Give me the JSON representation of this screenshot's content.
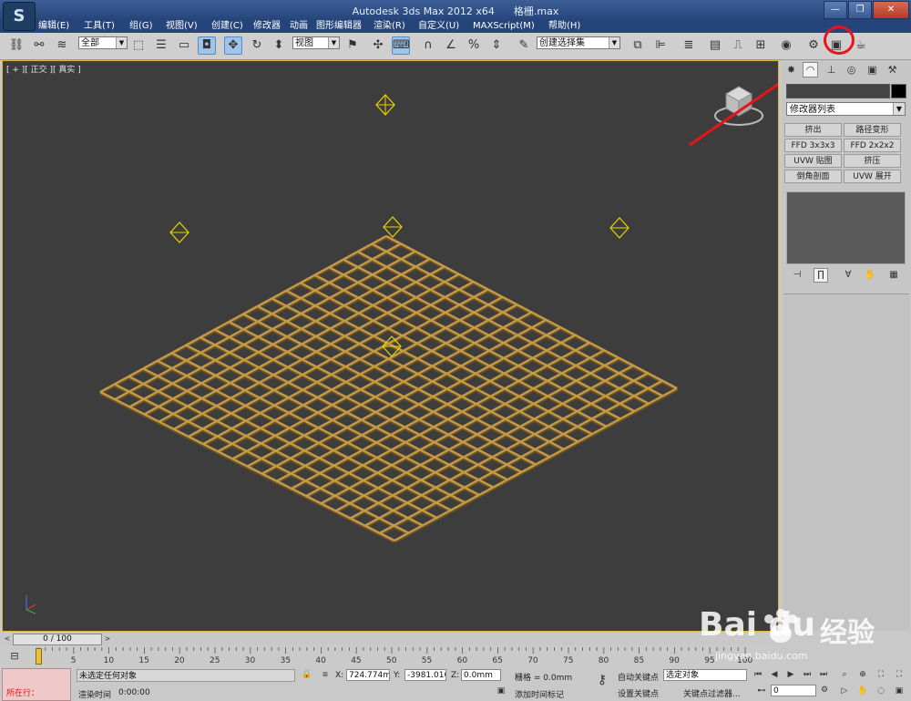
{
  "title": {
    "app": "Autodesk 3ds Max  2012 x64",
    "file": "格栅.max",
    "app_icon_letter": "S"
  },
  "window_buttons": {
    "minimize": "—",
    "restore": "❐",
    "close": "✕"
  },
  "menu": [
    "编辑(E)",
    "工具(T)",
    "组(G)",
    "视图(V)",
    "创建(C)",
    "修改器",
    "动画",
    "图形编辑器",
    "渲染(R)",
    "自定义(U)",
    "MAXScript(M)",
    "帮助(H)"
  ],
  "toolbar": {
    "selection_filter": "全部",
    "reference_coord": "视图",
    "named_selection": "创建选择集",
    "icons": [
      "link-icon",
      "unlink-icon",
      "bind-spacewarp-icon",
      "select-object-icon",
      "select-by-name-icon",
      "rect-selection-icon",
      "window-crossing-icon",
      "move-icon",
      "rotate-icon",
      "scale-icon",
      "pivot-icon",
      "manipulate-icon",
      "keyboard-shortcut-icon",
      "snap-3d-icon",
      "angle-snap-icon",
      "percent-snap-icon",
      "spinner-snap-icon",
      "edit-named-selection-icon",
      "mirror-icon",
      "align-icon",
      "layer-manager-icon",
      "ribbon-icon",
      "curve-editor-icon",
      "schematic-view-icon",
      "material-editor-icon",
      "render-setup-icon",
      "rendered-frame-window-icon",
      "render-production-icon"
    ]
  },
  "viewport": {
    "label": "[ + ][ 正交 ][ 真实 ]",
    "grid_divisions": 20
  },
  "command_panel": {
    "tabs": [
      "create-tab",
      "modify-tab",
      "hierarchy-tab",
      "motion-tab",
      "display-tab",
      "utilities-tab"
    ],
    "name_value": "",
    "modifier_list": "修改器列表",
    "modifier_buttons": [
      "挤出",
      "路径变形",
      "FFD 3x3x3",
      "FFD 2x2x2",
      "UVW 贴图",
      "挤压",
      "倒角剖面",
      "UVW 展开"
    ]
  },
  "time_slider": {
    "position": "0 / 100",
    "prev": "<",
    "next": ">"
  },
  "trackbar": {
    "ticks": [
      "0",
      "5",
      "10",
      "15",
      "20",
      "25",
      "30",
      "35",
      "40",
      "45",
      "50",
      "55",
      "60",
      "65",
      "70",
      "75",
      "80",
      "85",
      "90",
      "95",
      "100"
    ]
  },
  "status": {
    "selection_info": "未选定任何对象",
    "render_time_label": "渲染时间",
    "render_time": "0:00:00",
    "running_label": "所在行：",
    "x_label": "X:",
    "x_value": "724.774mm",
    "y_label": "Y:",
    "y_value": "-3981.016r",
    "z_label": "Z:",
    "z_value": "0.0mm",
    "grid": "栅格 = 0.0mm",
    "add_time_tag": "添加时间标记",
    "auto_key": "自动关键点",
    "set_key": "设置关键点",
    "selected_object": "选定对象",
    "key_filters": "关键点过滤器...",
    "frame": "0"
  },
  "watermark": {
    "brand": "Bai du",
    "word": "经验",
    "url": "jingyan.baidu.com"
  },
  "colors": {
    "viewport_bg": "#3d3d3d",
    "grid_object": "#c49a4a",
    "highlight": "#e8141a",
    "light_helper": "#e8d400"
  }
}
